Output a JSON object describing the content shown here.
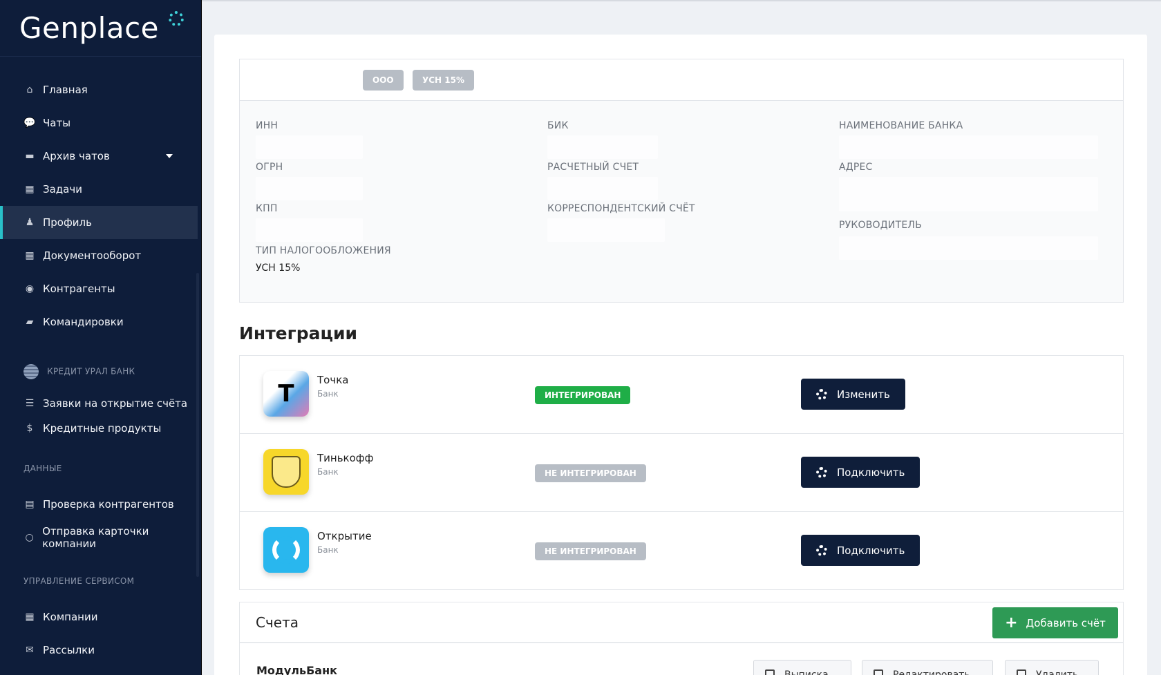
{
  "brand": {
    "name": "Genplace"
  },
  "sidebar": {
    "items": [
      {
        "label": "Главная",
        "icon": "home-icon"
      },
      {
        "label": "Чаты",
        "icon": "chat-icon"
      },
      {
        "label": "Архив чатов",
        "icon": "archive-icon"
      },
      {
        "label": "Задачи",
        "icon": "calendar-icon"
      },
      {
        "label": "Профиль",
        "icon": "user-icon"
      },
      {
        "label": "Документооборот",
        "icon": "document-grid-icon"
      },
      {
        "label": "Контрагенты",
        "icon": "target-icon"
      },
      {
        "label": "Командировки",
        "icon": "briefcase-icon"
      }
    ],
    "bank_section": "КРЕДИТ УРАЛ БАНК",
    "bank_items": [
      {
        "label": "Заявки на открытие счёта",
        "icon": "list-icon"
      },
      {
        "label": "Кредитные продукты",
        "icon": "dollar-icon"
      }
    ],
    "data_section": "ДАННЫЕ",
    "data_items": [
      {
        "label": "Проверка контрагентов",
        "icon": "card-icon"
      },
      {
        "label": "Отправка карточки компании",
        "icon": "circle-icon"
      }
    ],
    "service_section": "УПРАВЛЕНИЕ СЕРВИСОМ",
    "service_items": [
      {
        "label": "Компании",
        "icon": "table-icon"
      },
      {
        "label": "Рассылки",
        "icon": "mail-icon"
      }
    ]
  },
  "company": {
    "badges": [
      "ООО",
      "УСН 15%"
    ],
    "fields": {
      "inn": "ИНН",
      "ogrn": "ОГРН",
      "kpp": "КПП",
      "tax_type": "ТИП НАЛОГООБЛОЖЕНИЯ",
      "tax_value": "УСН 15%",
      "bik": "БИК",
      "account": "РАСЧЕТНЫЙ СЧЕТ",
      "corr_account": "КОРРЕСПОНДЕНТСКИЙ СЧЁТ",
      "bank_name": "НАИМЕНОВАНИЕ БАНКА",
      "address": "АДРЕС",
      "director": "РУКОВОДИТЕЛЬ"
    }
  },
  "integrations": {
    "title": "Интеграции",
    "rows": [
      {
        "name": "Точка",
        "type": "Банк",
        "status": "ИНТЕГРИРОВАН",
        "action": "Изменить",
        "logo_glyph": "Т"
      },
      {
        "name": "Тинькофф",
        "type": "Банк",
        "status": "НЕ ИНТЕГРИРОВАН",
        "action": "Подключить"
      },
      {
        "name": "Открытие",
        "type": "Банк",
        "status": "НЕ ИНТЕГРИРОВАН",
        "action": "Подключить"
      }
    ]
  },
  "accounts": {
    "title": "Счета",
    "add_label": "Добавить счёт",
    "row": {
      "name": "МодульБанк",
      "statement": "Выписка",
      "edit": "Редактировать",
      "delete": "Удалить"
    }
  },
  "colors": {
    "sidebar_bg": "#0e1d3a",
    "accent_teal": "#29c0c8",
    "status_ok": "#1fae47",
    "status_no": "#b7bdc5",
    "primary_btn": "#0f1e3a",
    "add_btn": "#2e9a55"
  }
}
